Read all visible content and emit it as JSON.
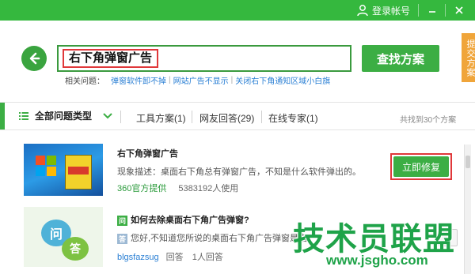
{
  "topbar": {
    "login_label": "登录帐号",
    "minimize_icon": "minimize-icon",
    "close_icon": "close-icon",
    "bg_color": "#35b83e"
  },
  "search": {
    "query": "右下角弹窗广告",
    "button_label": "查找方案"
  },
  "side_tab": {
    "label": "提交方案"
  },
  "related": {
    "label": "相关问题：",
    "links": [
      "弹窗软件卸不掉",
      "网站广告不显示",
      "关闭右下角通知区域小白旗"
    ]
  },
  "categories": {
    "all_label": "全部问题类型",
    "tabs": [
      "工具方案(1)",
      "网友回答(29)",
      "在线专家(1)"
    ],
    "count_text": "共找到30个方案"
  },
  "results": [
    {
      "title": "右下角弹窗广告",
      "description": "现象描述：桌面右下角总有弹窗广告，不知是什么软件弹出的。",
      "source": "360官方提供",
      "usage": "5383192人使用",
      "action_label": "立即修复",
      "thumb_icon": "windows-software-thumbnail"
    },
    {
      "title": "如何去除桌面右下角广告弹窗?",
      "description": "您好,不知道您所说的桌面右下角广告弹窗是指",
      "user": "blgsfazsug",
      "answer_label": "回答",
      "answer_count": "1人回答",
      "q_badge": "问",
      "a_badge": "答",
      "thumb_icon": "qa-bubbles-thumbnail"
    }
  ],
  "watermark": {
    "title": "技术员联盟",
    "url": "www.jsgho.com"
  },
  "colors": {
    "accent": "#3cae44",
    "highlight": "#e0383a",
    "link": "#2a7fd4"
  }
}
